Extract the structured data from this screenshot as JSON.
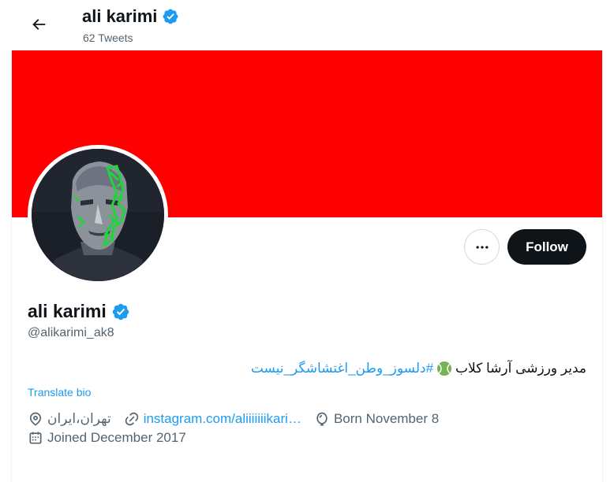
{
  "header": {
    "name": "ali karimi",
    "tweet_count": "62 Tweets"
  },
  "colors": {
    "banner": "#ff0000",
    "verified": "#1d9bf0",
    "link": "#1d9bf0",
    "follow_bg": "#0f1419",
    "muted": "#536471"
  },
  "profile": {
    "name": "ali karimi",
    "handle": "@alikarimi_ak8",
    "bio_text": "مدیر ورزشی آرشا کلاب",
    "bio_hashtag": "#دلسوز_وطن_اغتشاشگر_نیست",
    "translate_label": "Translate bio",
    "location": "تهران،ایران",
    "website": "instagram.com/aliiiiiiikari…",
    "birthday": "Born November 8",
    "joined": "Joined December 2017"
  },
  "actions": {
    "follow_label": "Follow"
  },
  "icons": {
    "back": "arrow-left-icon",
    "verified": "verified-badge-icon",
    "more": "more-horizontal-icon",
    "location": "location-pin-icon",
    "link": "link-icon",
    "birthday": "balloon-icon",
    "calendar": "calendar-icon",
    "tennis": "tennis-ball-emoji"
  }
}
